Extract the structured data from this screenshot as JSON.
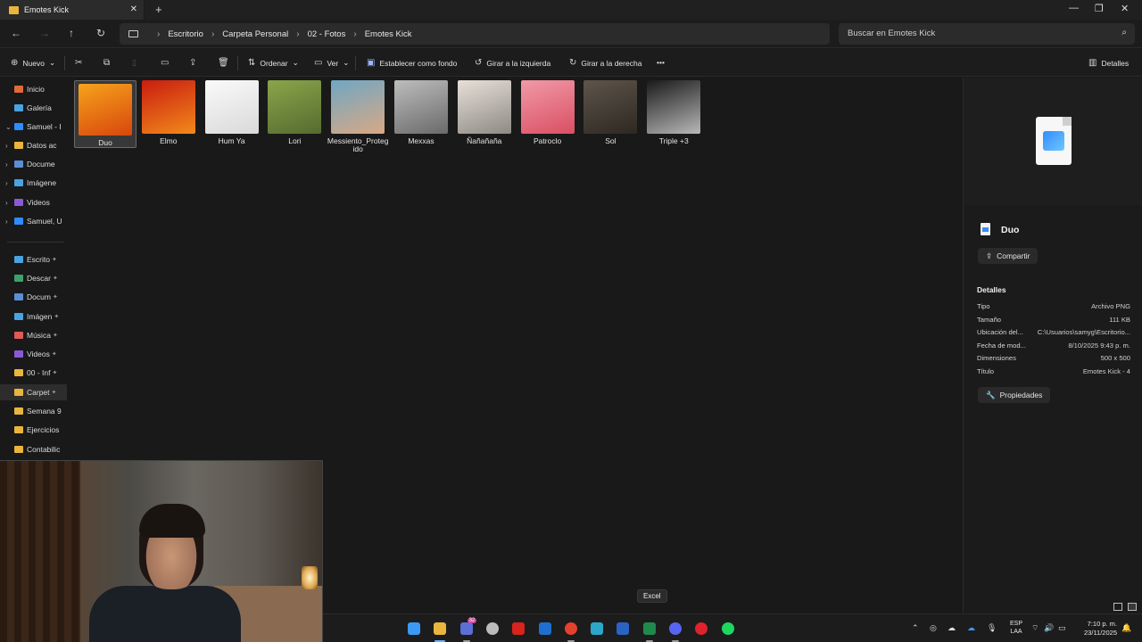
{
  "window": {
    "tab_title": "Emotes Kick",
    "new_tab": "+",
    "close": "✕",
    "minimize": "—",
    "maximize": "❐",
    "close_window": "✕"
  },
  "nav": {
    "back": "←",
    "forward": "→",
    "up": "↑",
    "refresh": "↻"
  },
  "breadcrumb": [
    "Escritorio",
    "Carpeta Personal",
    "02 - Fotos",
    "Emotes Kick"
  ],
  "search": {
    "placeholder": "Buscar en Emotes Kick",
    "icon": "⌕"
  },
  "toolbar": {
    "new": "Nuevo",
    "sort": "Ordenar",
    "view": "Ver",
    "set_background": "Establecer como fondo",
    "rotate_left": "Girar a la izquierda",
    "rotate_right": "Girar a la derecha",
    "more": "•••",
    "details": "Detalles",
    "cut_icon": "✂",
    "copy_icon": "⧉",
    "paste_icon": "📋",
    "rename_icon": "▭",
    "share_icon": "⇪",
    "delete_icon": "🗑"
  },
  "sidebar": {
    "items": [
      {
        "label": "Inicio",
        "color": "#e06a3a",
        "chevron": ""
      },
      {
        "label": "Galería",
        "color": "#4aa3df",
        "chevron": ""
      },
      {
        "label": "Samuel - I",
        "color": "#2f8cff",
        "chevron": "⌄"
      },
      {
        "label": "Datos ac",
        "color": "#e9b53c",
        "chevron": "›"
      },
      {
        "label": "Docume",
        "color": "#5a8fd6",
        "chevron": "›"
      },
      {
        "label": "Imágene",
        "color": "#4aa3df",
        "chevron": "›"
      },
      {
        "label": "Videos",
        "color": "#8a5ad6",
        "chevron": "›"
      },
      {
        "label": "Samuel, U",
        "color": "#2f8cff",
        "chevron": "›"
      },
      {
        "label": "Escrito",
        "color": "#4aa3df",
        "chevron": ""
      },
      {
        "label": "Descar",
        "color": "#3aa36a",
        "chevron": ""
      },
      {
        "label": "Docum",
        "color": "#5a8fd6",
        "chevron": ""
      },
      {
        "label": "Imágen",
        "color": "#4aa3df",
        "chevron": ""
      },
      {
        "label": "Música",
        "color": "#e05a5a",
        "chevron": ""
      },
      {
        "label": "Videos",
        "color": "#8a5ad6",
        "chevron": ""
      },
      {
        "label": "00 - Inf",
        "color": "#e9b53c",
        "chevron": ""
      },
      {
        "label": "Carpet",
        "color": "#e9b53c",
        "chevron": ""
      },
      {
        "label": "Semana 9",
        "color": "#e9b53c",
        "chevron": ""
      },
      {
        "label": "Ejercicios",
        "color": "#e9b53c",
        "chevron": ""
      },
      {
        "label": "Contabilic",
        "color": "#e9b53c",
        "chevron": ""
      }
    ],
    "pin": "✦"
  },
  "files": [
    {
      "name": "Duo",
      "colors": [
        "#f6a31b",
        "#d8460d"
      ]
    },
    {
      "name": "Elmo",
      "colors": [
        "#c91c10",
        "#f28a1a"
      ]
    },
    {
      "name": "Hum Ya",
      "colors": [
        "#fafafa",
        "#d9d9d9"
      ]
    },
    {
      "name": "Lori",
      "colors": [
        "#8aa54a",
        "#556b2f"
      ]
    },
    {
      "name": "Messiento_Protegido",
      "colors": [
        "#6fa7c4",
        "#d9a884"
      ]
    },
    {
      "name": "Mexxas",
      "colors": [
        "#bdbdbd",
        "#6a6a6a"
      ]
    },
    {
      "name": "Ñañañaña",
      "colors": [
        "#e6e0d8",
        "#8e8a84"
      ]
    },
    {
      "name": "Patroclo",
      "colors": [
        "#f19aa8",
        "#d94f62"
      ]
    },
    {
      "name": "Sol",
      "colors": [
        "#5e554b",
        "#2e2822"
      ]
    },
    {
      "name": "Triple +3",
      "colors": [
        "#1a1a1a",
        "#b8b8b8"
      ]
    }
  ],
  "details": {
    "file_name": "Duo",
    "share": "Compartir",
    "heading": "Detalles",
    "rows": [
      {
        "k": "Tipo",
        "v": "Archivo PNG"
      },
      {
        "k": "Tamaño",
        "v": "111 KB"
      },
      {
        "k": "Ubicación del...",
        "v": "C:\\Usuarios\\samyg\\Escritorio..."
      },
      {
        "k": "Fecha de mod...",
        "v": "8/10/2025 9:43 p. m."
      },
      {
        "k": "Dimensiones",
        "v": "500 x 500"
      },
      {
        "k": "Título",
        "v": "Emotes Kick - 4"
      }
    ],
    "properties": "Propiedades"
  },
  "taskbar": {
    "tooltip": "Excel",
    "badge": "32",
    "lang_top": "ESP",
    "lang_bottom": "LAA",
    "time": "7:10 p. m.",
    "date": "23/11/2025",
    "apps": [
      {
        "name": "windows-start",
        "color": "#3a9af5"
      },
      {
        "name": "file-explorer",
        "color": "#e9b53c"
      },
      {
        "name": "teams",
        "color": "#5b6fd6"
      },
      {
        "name": "copilot",
        "color": "#bbbbbb"
      },
      {
        "name": "netflix",
        "color": "#d8231e"
      },
      {
        "name": "outlook",
        "color": "#1f6fd0"
      },
      {
        "name": "chrome",
        "color": "#e5412f"
      },
      {
        "name": "edge",
        "color": "#2da7c9"
      },
      {
        "name": "word",
        "color": "#2b63c4"
      },
      {
        "name": "excel",
        "color": "#1f8a4c"
      },
      {
        "name": "discord",
        "color": "#5865f2"
      },
      {
        "name": "opera",
        "color": "#e0222d"
      },
      {
        "name": "spotify",
        "color": "#1ed760"
      }
    ]
  }
}
